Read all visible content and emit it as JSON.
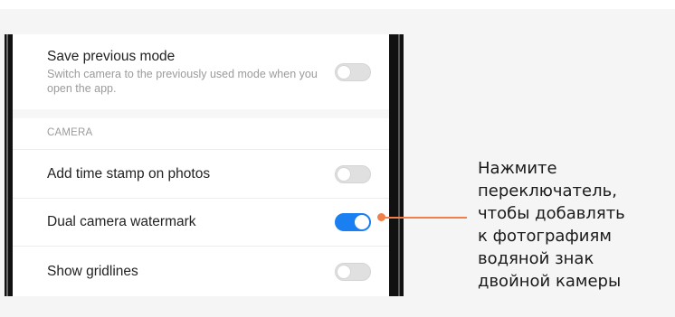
{
  "settings": {
    "save_previous_mode": {
      "title": "Save previous mode",
      "description": "Switch camera to the previously used mode when you open the app.",
      "enabled": false
    },
    "section_header": "CAMERA",
    "add_time_stamp": {
      "label": "Add time stamp on photos",
      "enabled": false
    },
    "dual_camera_watermark": {
      "label": "Dual camera watermark",
      "enabled": true
    },
    "show_gridlines": {
      "label": "Show gridlines",
      "enabled": false
    }
  },
  "callout": {
    "lines": [
      "Нажмите",
      "переключатель,",
      "чтобы добавлять",
      "к фотографиям",
      "водяной знак",
      "двойной камеры"
    ]
  },
  "colors": {
    "toggle_on": "#1a7ff0",
    "callout_accent": "#f0804a"
  }
}
